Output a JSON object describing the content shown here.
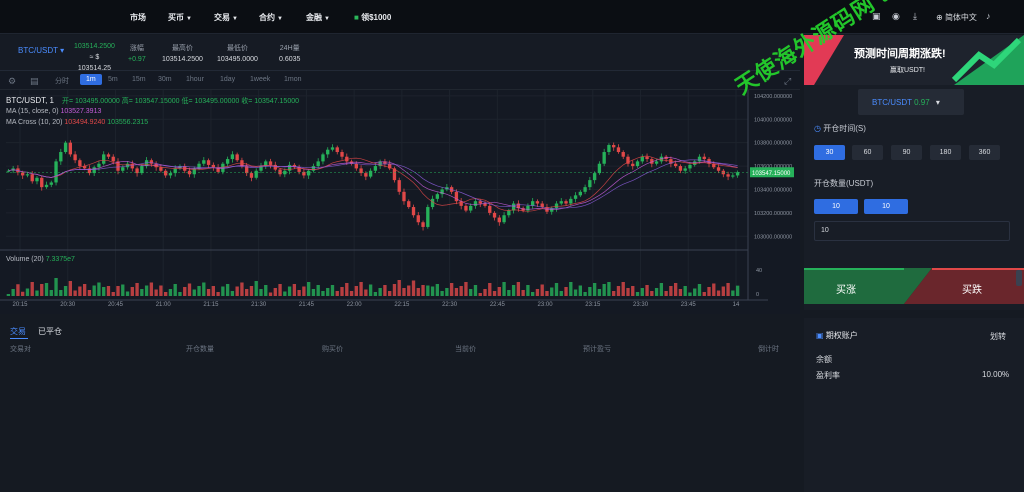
{
  "nav": {
    "items": [
      {
        "label": "市场",
        "caret": false
      },
      {
        "label": "买币",
        "caret": true
      },
      {
        "label": "交易",
        "caret": true
      },
      {
        "label": "合约",
        "caret": true
      },
      {
        "label": "金融",
        "caret": true
      }
    ],
    "promo": "领$1000",
    "language": "简体中文"
  },
  "ticker": {
    "pair": "BTC/USDT",
    "price_top": "103514.2500",
    "price_eq": "≈ $",
    "price_usd": "103514.25",
    "fields": [
      {
        "label": "涨幅",
        "value": "+0.97"
      },
      {
        "label": "最高价",
        "value": "103514.2500"
      },
      {
        "label": "最低价",
        "value": "103495.0000"
      },
      {
        "label": "24H量",
        "value": "0.6035"
      }
    ]
  },
  "timeframes": [
    "分时",
    "1m",
    "5m",
    "15m",
    "30m",
    "1hour",
    "1day",
    "1week",
    "1mon"
  ],
  "active_timeframe": "1m",
  "chart_legend": {
    "symbol": "BTC/USDT, 1",
    "ohlc": "开= 103495.00000  高= 103547.15000  低= 103495.00000  收= 103547.15000",
    "ma": "MA (15, close, 0)",
    "ma_value": "103527.3913",
    "ma_cross": "MA Cross (10, 20)",
    "ma_cross_v1": "103494.9240",
    "ma_cross_v2": "103556.2315",
    "volume": "Volume (20)",
    "volume_value": "7.3375e7"
  },
  "chart_data": {
    "type": "candlestick",
    "price_axis": [
      "104200.000000",
      "104000.000000",
      "103800.000000",
      "103600.000000",
      "103400.000000",
      "103200.000000",
      "103000.000000"
    ],
    "ylim": [
      102900,
      104250
    ],
    "current_price_label": "103547.15000",
    "volume_axis": [
      "40",
      "0"
    ],
    "time_axis": [
      "20:15",
      "20:30",
      "20:45",
      "21:00",
      "21:15",
      "21:30",
      "21:45",
      "22:00",
      "22:15",
      "22:30",
      "22:45",
      "23:00",
      "23:15",
      "23:30",
      "23:45",
      "14"
    ],
    "close_series": [
      103560,
      103580,
      103545,
      103520,
      103530,
      103470,
      103500,
      103420,
      103440,
      103460,
      103640,
      103720,
      103800,
      103700,
      103650,
      103600,
      103580,
      103540,
      103590,
      103620,
      103700,
      103680,
      103640,
      103560,
      103590,
      103620,
      103580,
      103540,
      103600,
      103650,
      103620,
      103590,
      103560,
      103520,
      103540,
      103580,
      103600,
      103560,
      103530,
      103580,
      103620,
      103650,
      103610,
      103590,
      103550,
      103620,
      103660,
      103700,
      103650,
      103600,
      103540,
      103500,
      103560,
      103600,
      103640,
      103610,
      103570,
      103530,
      103560,
      103610,
      103590,
      103550,
      103520,
      103560,
      103600,
      103640,
      103700,
      103740,
      103760,
      103720,
      103680,
      103640,
      103620,
      103580,
      103540,
      103510,
      103560,
      103600,
      103640,
      103620,
      103580,
      103480,
      103380,
      103300,
      103250,
      103180,
      103120,
      103080,
      103250,
      103320,
      103360,
      103400,
      103420,
      103380,
      103300,
      103260,
      103220,
      103260,
      103300,
      103280,
      103260,
      103200,
      103160,
      103120,
      103180,
      103220,
      103280,
      103240,
      103220,
      103260,
      103300,
      103280,
      103250,
      103210,
      103240,
      103280,
      103300,
      103280,
      103320,
      103350,
      103380,
      103420,
      103480,
      103540,
      103620,
      103720,
      103780,
      103760,
      103720,
      103680,
      103620,
      103600,
      103640,
      103680,
      103660,
      103620,
      103640,
      103680,
      103660,
      103620,
      103600,
      103560,
      103580,
      103610,
      103640,
      103680,
      103660,
      103620,
      103590,
      103560,
      103530,
      103510,
      103520,
      103547
    ]
  },
  "orders": {
    "tabs": [
      "交易",
      "已平仓"
    ],
    "columns": [
      "交易对",
      "开仓数量",
      "购买价",
      "当前价",
      "预计盈亏",
      "倒计时"
    ]
  },
  "trade_panel": {
    "banner_title": "预测时间周期涨跌!",
    "banner_sub": "赢取USDT!",
    "pair": "BTC/USDT",
    "pair_change": "0.97",
    "open_time_label": "开仓时间(S)",
    "times": [
      "30",
      "60",
      "90",
      "180",
      "360"
    ],
    "qty_label": "开仓数量(USDT)",
    "qtys": [
      "10",
      "10"
    ],
    "qty_input": "10",
    "buy_up": "买涨",
    "buy_down": "买跌"
  },
  "account": {
    "title": "期权账户",
    "transfer": "划转",
    "balance_label": "余额",
    "profit_label": "盈利率",
    "profit_value": "10.00%"
  },
  "watermark": "天使海外源码网 tcym.cc",
  "colors": {
    "up": "#26b15a",
    "down": "#e04848",
    "accent": "#2f6de1",
    "ma_purple": "#8a5cd8"
  }
}
